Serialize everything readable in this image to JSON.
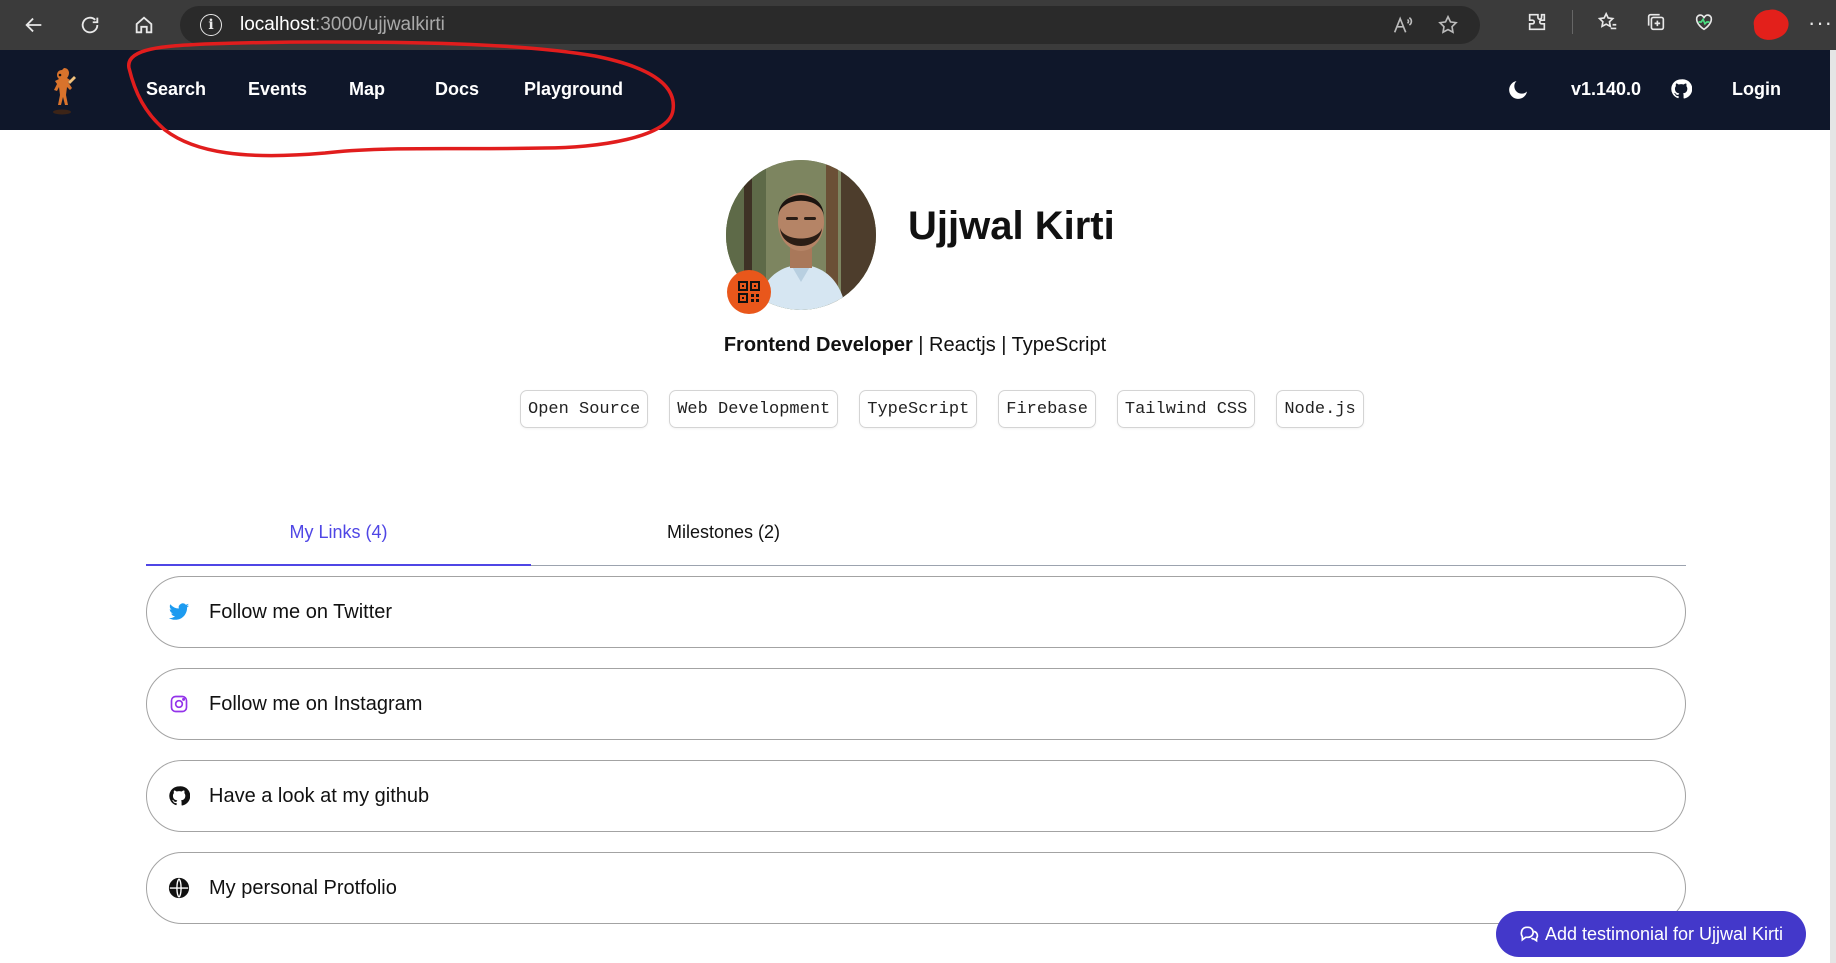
{
  "browser": {
    "url_host": "localhost",
    "url_path": ":3000/ujjwalkirti"
  },
  "nav": {
    "items": [
      {
        "label": "Search"
      },
      {
        "label": "Events"
      },
      {
        "label": "Map"
      },
      {
        "label": "Docs"
      },
      {
        "label": "Playground"
      }
    ],
    "version": "v1.140.0",
    "login": "Login"
  },
  "profile": {
    "name": "Ujjwal Kirti",
    "bio_strong": "Frontend Developer",
    "bio_rest": " | Reactjs | TypeScript",
    "tags": [
      "Open Source",
      "Web Development",
      "TypeScript",
      "Firebase",
      "Tailwind CSS",
      "Node.js"
    ]
  },
  "tabs": [
    {
      "label": "My Links (4)",
      "active": true
    },
    {
      "label": "Milestones (2)",
      "active": false
    }
  ],
  "links": [
    {
      "label": "Follow me on Twitter",
      "icon": "twitter-icon"
    },
    {
      "label": "Follow me on Instagram",
      "icon": "instagram-icon"
    },
    {
      "label": "Have a look at my github",
      "icon": "github-icon"
    },
    {
      "label": "My personal Protfolio",
      "icon": "globe-icon"
    }
  ],
  "cta": {
    "label": "Add testimonial for Ujjwal Kirti"
  },
  "colors": {
    "nav_bg": "#0f172a",
    "accent": "#4f46e5",
    "cta_bg": "#4338ca",
    "qr_badge": "#e9571b",
    "annotation": "#e11d1d"
  }
}
